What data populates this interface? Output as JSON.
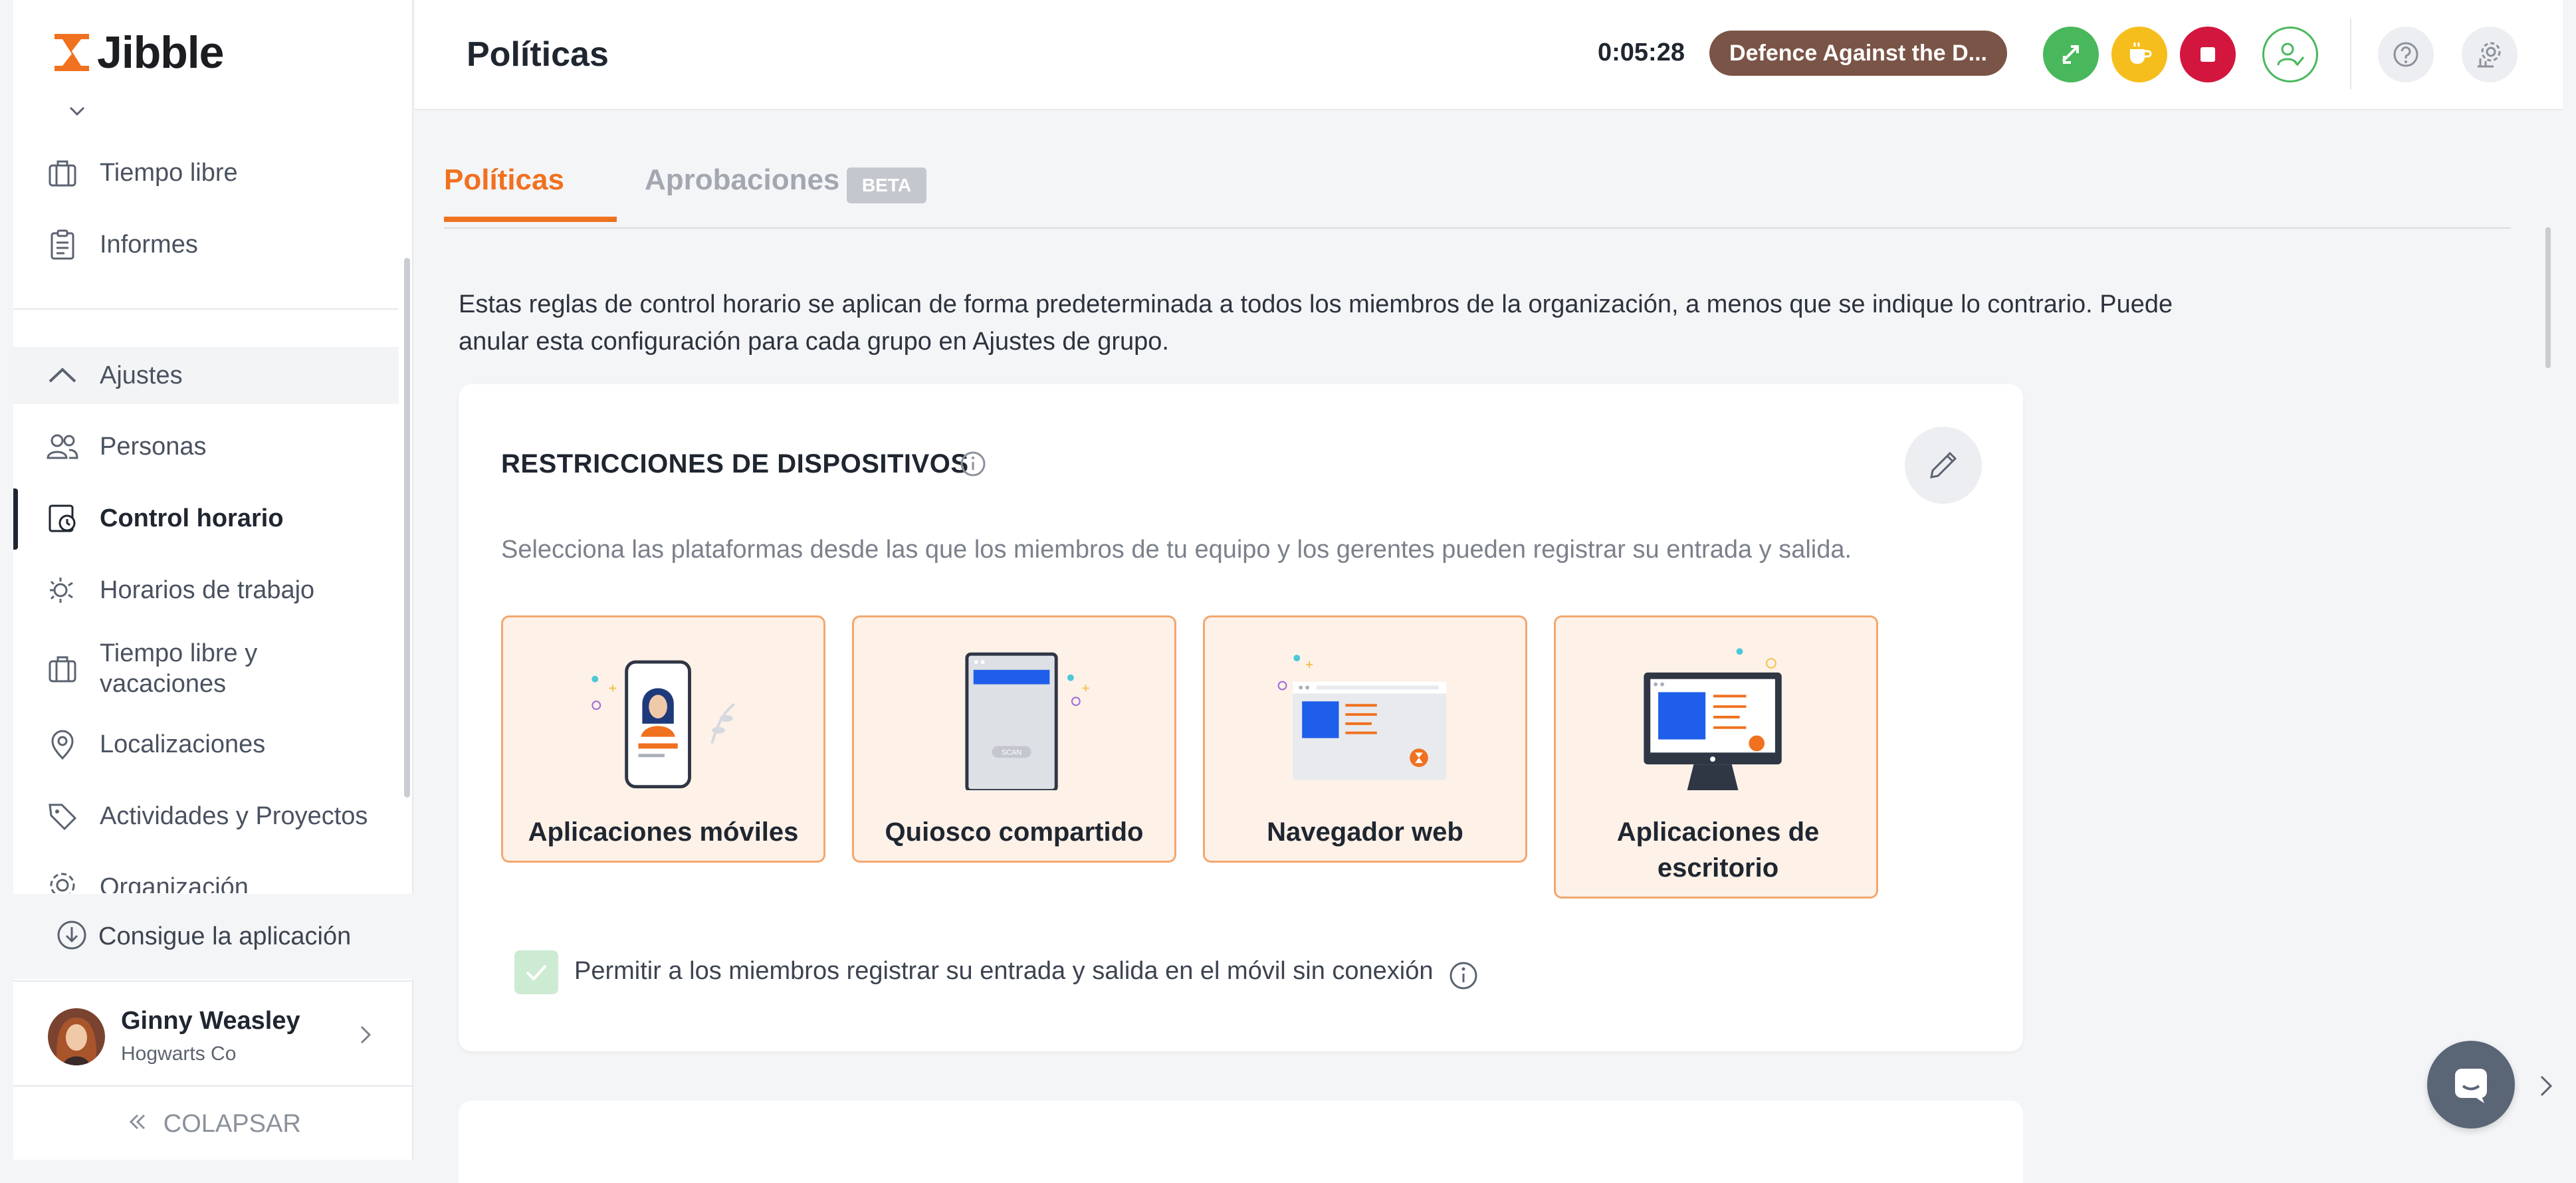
{
  "app": {
    "name": "Jibble"
  },
  "sidebar": {
    "items": [
      {
        "label": "Tiempo libre",
        "icon": "suitcase-icon"
      },
      {
        "label": "Informes",
        "icon": "clipboard-icon"
      },
      {
        "label": "Ajustes",
        "icon": "chevron-up-icon"
      },
      {
        "label": "Personas",
        "icon": "people-icon"
      },
      {
        "label": "Control horario",
        "icon": "time-tracking-icon"
      },
      {
        "label": "Horarios de trabajo",
        "icon": "work-schedule-icon"
      },
      {
        "label": "Tiempo libre y vacaciones",
        "icon": "suitcase-icon"
      },
      {
        "label": "Localizaciones",
        "icon": "location-pin-icon"
      },
      {
        "label": "Actividades y Proyectos",
        "icon": "tag-icon"
      },
      {
        "label": "Organización",
        "icon": "gear-icon"
      }
    ],
    "get_app": "Consigue la aplicación",
    "user": {
      "name": "Ginny Weasley",
      "org": "Hogwarts Co"
    },
    "collapse": "COLAPSAR"
  },
  "header": {
    "title": "Políticas",
    "timer": "0:05:28",
    "activity": "Defence Against the D..."
  },
  "tabs": {
    "policies": "Políticas",
    "approvals": "Aprobaciones",
    "beta": "BETA"
  },
  "main": {
    "intro_line1": "Estas reglas de control horario se aplican de forma predeterminada a todos los miembros de la organización, a menos que se indique lo contrario. Puede",
    "intro_line2": "anular esta configuración para cada grupo en Ajustes de grupo.",
    "card": {
      "title": "RESTRICCIONES DE DISPOSITIVOS",
      "description": "Selecciona las plataformas desde las que los miembros de tu equipo y los gerentes pueden registrar su entrada y salida.",
      "tiles": [
        {
          "label": "Aplicaciones móviles"
        },
        {
          "label": "Quiosco compartido"
        },
        {
          "label": "Navegador web"
        },
        {
          "label": "Aplicaciones de escritorio"
        }
      ],
      "kiosk_scan_text": "SCAN",
      "checkbox_label": "Permitir a los miembros registrar su entrada y salida en el móvil sin conexión"
    }
  },
  "colors": {
    "accent": "#f0711f",
    "tile_bg": "#fdf1e8",
    "tile_border": "#f3a76f",
    "activity_pill": "#7a5446",
    "green": "#49b85c",
    "yellow": "#f6be1d",
    "red": "#d2163e"
  }
}
